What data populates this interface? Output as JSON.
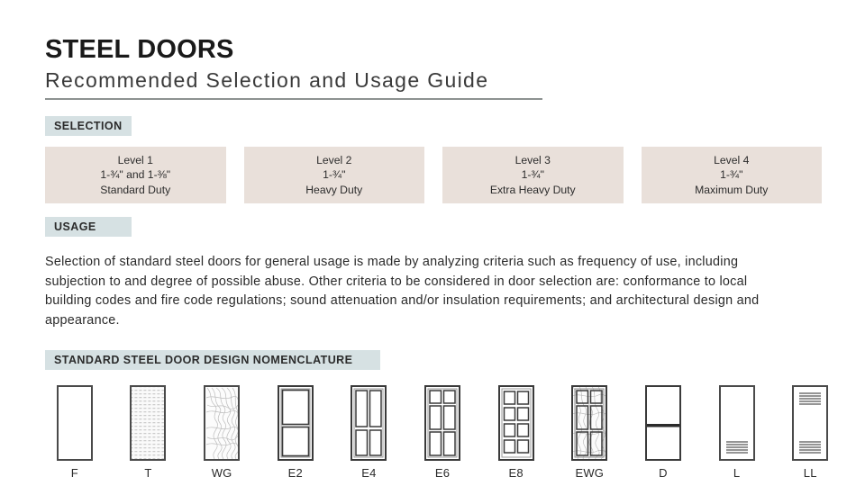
{
  "header": {
    "title": "STEEL DOORS",
    "subtitle": "Recommended Selection and Usage Guide"
  },
  "sections": {
    "selection_label": "SELECTION",
    "usage_label": "USAGE",
    "nomenclature_label": "STANDARD STEEL DOOR DESIGN NOMENCLATURE"
  },
  "selection": {
    "levels": [
      {
        "name": "Level 1",
        "thickness": "1-¾\" and 1-⅜\"",
        "duty": "Standard Duty"
      },
      {
        "name": "Level 2",
        "thickness": "1-¾\"",
        "duty": "Heavy Duty"
      },
      {
        "name": "Level 3",
        "thickness": "1-¾\"",
        "duty": "Extra Heavy Duty"
      },
      {
        "name": "Level 4",
        "thickness": "1-¾\"",
        "duty": "Maximum Duty"
      }
    ]
  },
  "usage": {
    "paragraph": "Selection of standard steel doors for general usage is made by analyzing criteria such as frequency of use, including subjection to and degree of possible abuse. Other criteria to be considered in door selection are: conformance to local building codes and fire code regulations; sound attenuation and/or insulation requirements; and architectural design and appearance."
  },
  "nomenclature": {
    "doors": [
      {
        "code": "F",
        "style": "flush"
      },
      {
        "code": "T",
        "style": "textured"
      },
      {
        "code": "WG",
        "style": "woodgrain"
      },
      {
        "code": "E2",
        "style": "panel-1x2"
      },
      {
        "code": "E4",
        "style": "panel-2x2"
      },
      {
        "code": "E6",
        "style": "panel-2x3"
      },
      {
        "code": "E8",
        "style": "panel-2x4"
      },
      {
        "code": "EWG",
        "style": "panel-2x3-woodgrain"
      },
      {
        "code": "D",
        "style": "dutch"
      },
      {
        "code": "L",
        "style": "louver-bottom"
      },
      {
        "code": "LL",
        "style": "louver-top-bottom"
      }
    ]
  },
  "colors": {
    "chip_background": "#d6e1e3",
    "level_background": "#e9e0da",
    "rule": "#8d9291",
    "door_outline": "#4a4a4a",
    "text": "#2a2a2a"
  }
}
